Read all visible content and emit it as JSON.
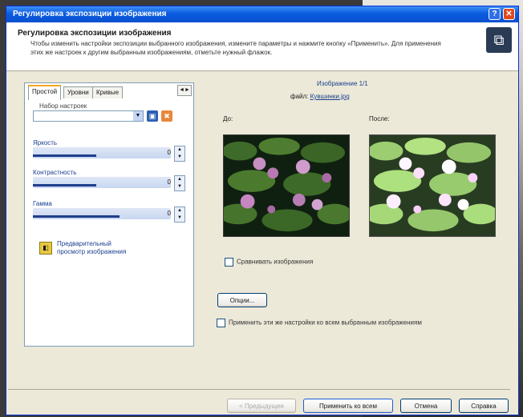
{
  "window": {
    "title": "Регулировка экспозиции изображения",
    "help_glyph": "?",
    "close_glyph": "✕"
  },
  "header": {
    "title": "Регулировка экспозиции изображения",
    "description": "Чтобы изменить настройки экспозиции выбранного изображения, измените параметры и нажмите кнопку «Применить». Для применения этих же настроек к другим выбранным изображениям, отметьте нужный флажок.",
    "icon_name": "exposure-icon"
  },
  "left": {
    "tabs": [
      "Простой",
      "Уровни",
      "Кривые"
    ],
    "tab_arrows": "◄►",
    "presets_label": "Набор настроек",
    "sliders": [
      {
        "label": "Яркость",
        "value": "0",
        "fill": 0.46
      },
      {
        "label": "Контрастность",
        "value": "0",
        "fill": 0.46
      },
      {
        "label": "Гамма",
        "value": "0",
        "fill": 0.63
      }
    ],
    "preview": {
      "text": "Предварительный просмотр изображения"
    }
  },
  "right": {
    "title": "Изображение 1/1",
    "file_prefix": "файл: ",
    "file_link": "Кувшинки.jpg",
    "before_label": "До:",
    "after_label": "После:",
    "compare_label": "Сравнивать изображения",
    "options_button": "Опции...",
    "apply_all_label": "Применить эти же настройки ко всем выбранным изображениям"
  },
  "footer": {
    "prev": "< Предыдущее",
    "apply": "Применить ко всем",
    "cancel": "Отмена",
    "help": "Справка"
  }
}
